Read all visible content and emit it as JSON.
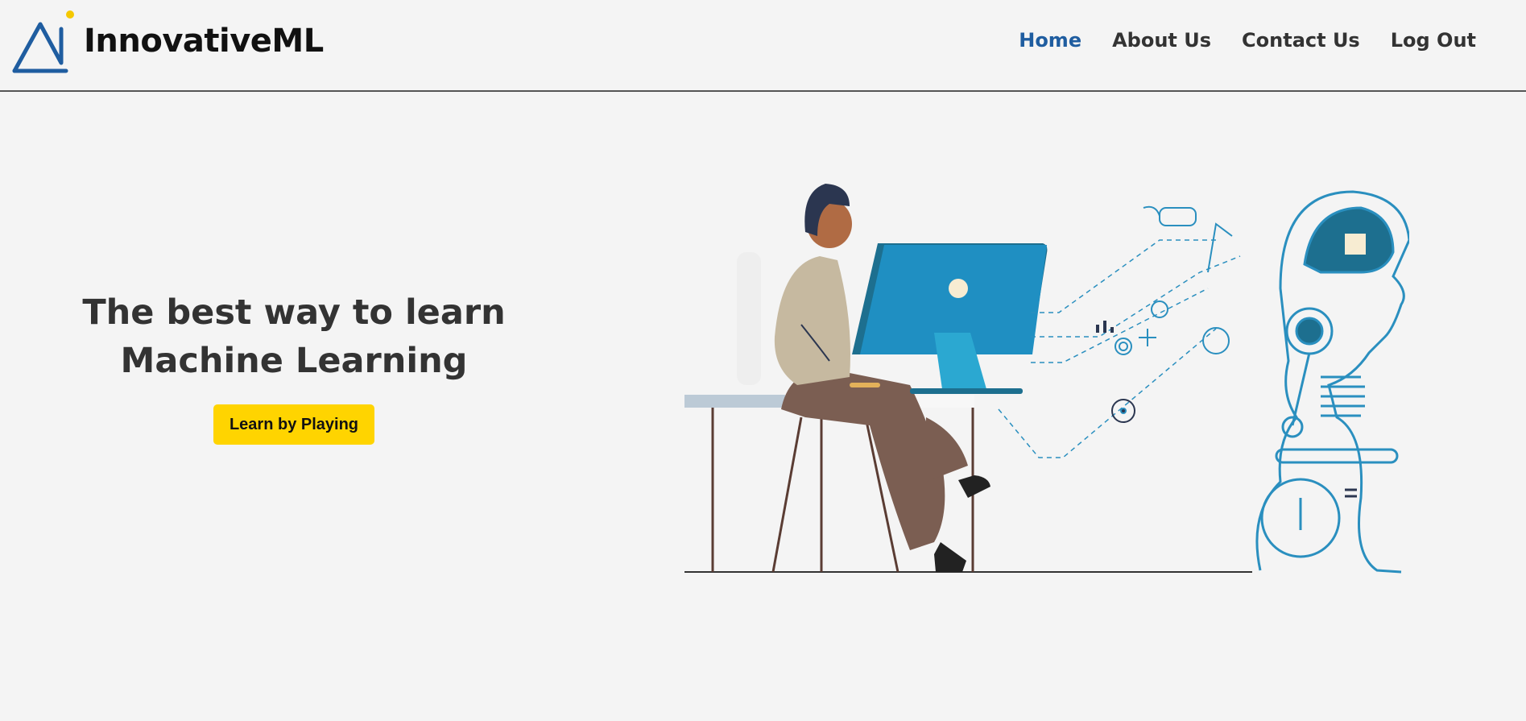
{
  "brand": {
    "name": "InnovativeML"
  },
  "nav": {
    "items": [
      {
        "label": "Home",
        "active": true
      },
      {
        "label": "About Us",
        "active": false
      },
      {
        "label": "Contact Us",
        "active": false
      },
      {
        "label": "Log Out",
        "active": false
      }
    ]
  },
  "hero": {
    "title_line1": "The best way to learn",
    "title_line2": "Machine Learning",
    "cta_label": "Learn by Playing"
  },
  "colors": {
    "accent": "#1f5da0",
    "cta": "#ffd400",
    "background": "#f4f4f4",
    "illustration_blue": "#2a8fbf"
  },
  "icons": [
    "logo-triangle-icon",
    "person-at-computer-illustration",
    "ai-robot-head-illustration"
  ]
}
